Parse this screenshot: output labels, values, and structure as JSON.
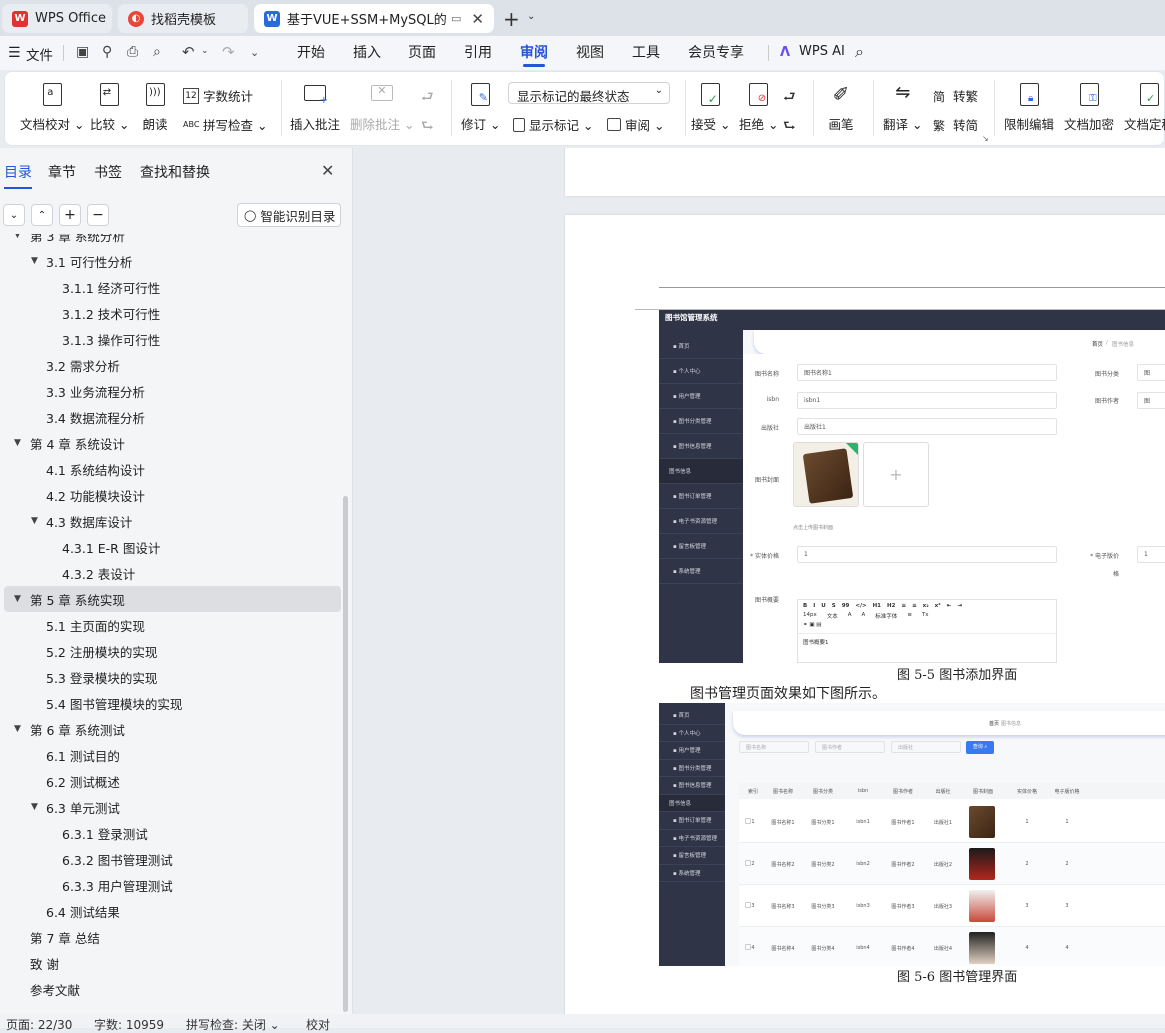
{
  "tabs": [
    {
      "label": "WPS Office",
      "logo": "W"
    },
    {
      "label": "找稻壳模板",
      "logo": "找"
    },
    {
      "label": "基于VUE+SSM+MySQL的图",
      "logo": "W"
    }
  ],
  "menu": {
    "file": "文件",
    "items": [
      "开始",
      "插入",
      "页面",
      "引用",
      "审阅",
      "视图",
      "工具",
      "会员专享"
    ],
    "active": "审阅",
    "ai": "WPS AI"
  },
  "ribbon": {
    "doc_check": "文档校对",
    "compare": "比较",
    "read_aloud": "朗读",
    "word_count": "字数统计",
    "spell_check": "拼写检查",
    "insert_comment": "插入批注",
    "delete_comment": "删除批注",
    "revise": "修订",
    "markup_select": "显示标记的最终状态",
    "show_markup": "显示标记",
    "review": "审阅",
    "accept": "接受",
    "reject": "拒绝",
    "pen": "画笔",
    "translate": "翻译",
    "to_traditional": "转繁",
    "to_simplified": "转简",
    "restrict_edit": "限制编辑",
    "encrypt": "文档加密",
    "finalize": "文档定稿"
  },
  "sidebar": {
    "tabs": [
      "目录",
      "章节",
      "书签",
      "查找和替换"
    ],
    "smart_toc": "智能识别目录",
    "toc": [
      {
        "text": "第 3 章  系统分析",
        "level": 1,
        "arrow": "down"
      },
      {
        "text": "3.1 可行性分析",
        "level": 2,
        "arrow": "down"
      },
      {
        "text": "3.1.1 经济可行性",
        "level": 3
      },
      {
        "text": "3.1.2 技术可行性",
        "level": 3
      },
      {
        "text": "3.1.3 操作可行性",
        "level": 3
      },
      {
        "text": "3.2 需求分析",
        "level": 2
      },
      {
        "text": "3.3 业务流程分析",
        "level": 2
      },
      {
        "text": "3.4 数据流程分析",
        "level": 2
      },
      {
        "text": "第 4 章  系统设计",
        "level": 1,
        "arrow": "down"
      },
      {
        "text": "4.1 系统结构设计",
        "level": 2
      },
      {
        "text": "4.2 功能模块设计",
        "level": 2
      },
      {
        "text": "4.3 数据库设计",
        "level": 2,
        "arrow": "down"
      },
      {
        "text": "4.3.1 E-R 图设计",
        "level": 3
      },
      {
        "text": "4.3.2 表设计",
        "level": 3
      },
      {
        "text": "第 5 章    系统实现",
        "level": 1,
        "arrow": "down",
        "selected": true
      },
      {
        "text": "5.1 主页面的实现",
        "level": 2
      },
      {
        "text": "5.2 注册模块的实现",
        "level": 2
      },
      {
        "text": "5.3 登录模块的实现",
        "level": 2
      },
      {
        "text": "5.4 图书管理模块的实现",
        "level": 2
      },
      {
        "text": "第 6 章    系统测试",
        "level": 1,
        "arrow": "down"
      },
      {
        "text": "6.1 测试目的",
        "level": 2
      },
      {
        "text": "6.2 测试概述",
        "level": 2
      },
      {
        "text": "6.3 单元测试",
        "level": 2,
        "arrow": "down"
      },
      {
        "text": "6.3.1 登录测试",
        "level": 3
      },
      {
        "text": "6.3.2 图书管理测试",
        "level": 3
      },
      {
        "text": "6.3.3 用户管理测试",
        "level": 3
      },
      {
        "text": "6.4 测试结果",
        "level": 2
      },
      {
        "text": "第 7 章    总结",
        "level": 1
      },
      {
        "text": "致    谢",
        "level": 1
      },
      {
        "text": "参考文献",
        "level": 1
      }
    ]
  },
  "document": {
    "fig1": {
      "app_title": "图书馆管理系统",
      "breadcrumb_home": "首页",
      "breadcrumb_current": "图书信息",
      "menu": [
        "首页",
        "个人中心",
        "用户管理",
        "图书分类管理",
        "图书信息管理",
        "图书信息",
        "图书订单管理",
        "电子书资源管理",
        "留言板管理",
        "系统管理"
      ],
      "labels": {
        "name": "图书名称",
        "isbn": "isbn",
        "publisher": "出版社",
        "cover": "图书封面",
        "price": "* 实体价格",
        "summary": "图书概要",
        "category": "图书分类",
        "author": "图书作者",
        "eprice": "* 电子版价",
        "eprice_unit": "格"
      },
      "values": {
        "name": "图书名称1",
        "isbn": "isbn1",
        "publisher": "出版社1",
        "price": "1",
        "eprice": "1",
        "summary": "图书概要1"
      },
      "upload_hint": "点击上传图书封面",
      "editor_toolbar": [
        "B",
        "I",
        "U",
        "S",
        "99",
        "</>",
        "H1",
        "H2",
        "≡",
        "≡",
        "x₂",
        "x²",
        "⇤",
        "⇥"
      ],
      "editor_row2": [
        "14px",
        "文本",
        "A",
        "A",
        "标准字体",
        "≡",
        "Tx"
      ],
      "caption": "图 5-5  图书添加界面"
    },
    "paragraph": "图书管理页面效果如下图所示。",
    "fig2": {
      "breadcrumb_home": "首页",
      "breadcrumb_current": "图书信息",
      "search_placeholders": [
        "图书名称",
        "图书作者",
        "出版社"
      ],
      "search_button": "查询",
      "menu": [
        "首页",
        "个人中心",
        "用户管理",
        "图书分类管理",
        "图书信息管理",
        "图书信息",
        "图书订单管理",
        "电子书资源管理",
        "留言板管理",
        "系统管理"
      ],
      "headers": [
        "索引",
        "图书名称",
        "图书分类",
        "isbn",
        "图书作者",
        "出版社",
        "图书封面",
        "实体价格",
        "电子版价格"
      ],
      "rows": [
        [
          "1",
          "图书名称1",
          "图书分类1",
          "isbn1",
          "图书作者1",
          "出版社1",
          "",
          "1",
          "1"
        ],
        [
          "2",
          "图书名称2",
          "图书分类2",
          "isbn2",
          "图书作者2",
          "出版社2",
          "",
          "2",
          "2"
        ],
        [
          "3",
          "图书名称3",
          "图书分类3",
          "isbn3",
          "图书作者3",
          "出版社3",
          "",
          "3",
          "3"
        ],
        [
          "4",
          "图书名称4",
          "图书分类4",
          "isbn4",
          "图书作者4",
          "出版社4",
          "",
          "4",
          "4"
        ]
      ],
      "caption": "图 5-6  图书管理界面"
    }
  },
  "status": {
    "page": "页面: 22/30",
    "words": "字数: 10959",
    "spell": "拼写检查: 关闭",
    "proof": "校对"
  }
}
